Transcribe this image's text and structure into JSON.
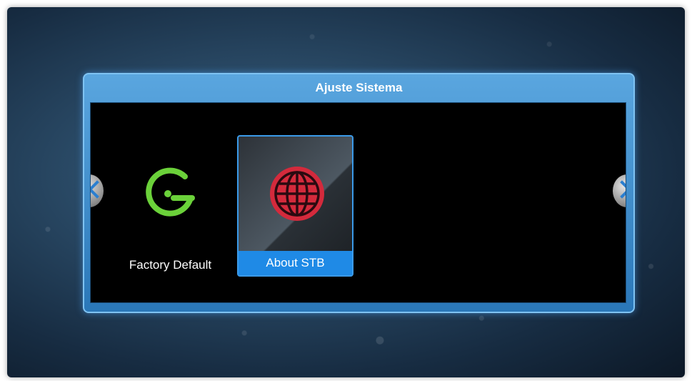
{
  "dialog": {
    "title": "Ajuste Sistema"
  },
  "menu": {
    "items": [
      {
        "label": "Factory Default",
        "icon": "factory-reset-icon",
        "icon_color": "#6bd13a",
        "selected": false
      },
      {
        "label": "About STB",
        "icon": "globe-icon",
        "icon_color": "#d42a3c",
        "selected": true
      }
    ]
  },
  "navigation": {
    "left_icon": "chevron-left-icon",
    "right_icon": "chevron-right-icon"
  },
  "colors": {
    "accent": "#1f8ae6",
    "frame": "#3b8fd6"
  }
}
